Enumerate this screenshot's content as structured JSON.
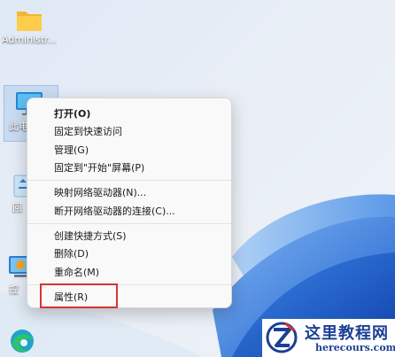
{
  "desktop": {
    "icons": [
      {
        "name": "folder",
        "label": "Administr..."
      },
      {
        "name": "this-pc",
        "label": "此电"
      },
      {
        "name": "recycle",
        "label": "回"
      },
      {
        "name": "control-panel",
        "label": "控"
      },
      {
        "name": "edge",
        "label": ""
      }
    ]
  },
  "context_menu": {
    "items": [
      {
        "label": "打开(O)",
        "bold": true
      },
      {
        "label": "固定到快速访问"
      },
      {
        "label": "管理(G)"
      },
      {
        "label": "固定到\"开始\"屏幕(P)"
      },
      {
        "label": "映射网络驱动器(N)..."
      },
      {
        "label": "断开网络驱动器的连接(C)..."
      },
      {
        "label": "创建快捷方式(S)"
      },
      {
        "label": "删除(D)"
      },
      {
        "label": "重命名(M)"
      },
      {
        "label": "属性(R)"
      }
    ]
  },
  "watermark": {
    "title": "这里教程网",
    "url": "herecours.com"
  },
  "colors": {
    "highlight": "#d9332f",
    "watermark_text": "#1c3f94"
  }
}
